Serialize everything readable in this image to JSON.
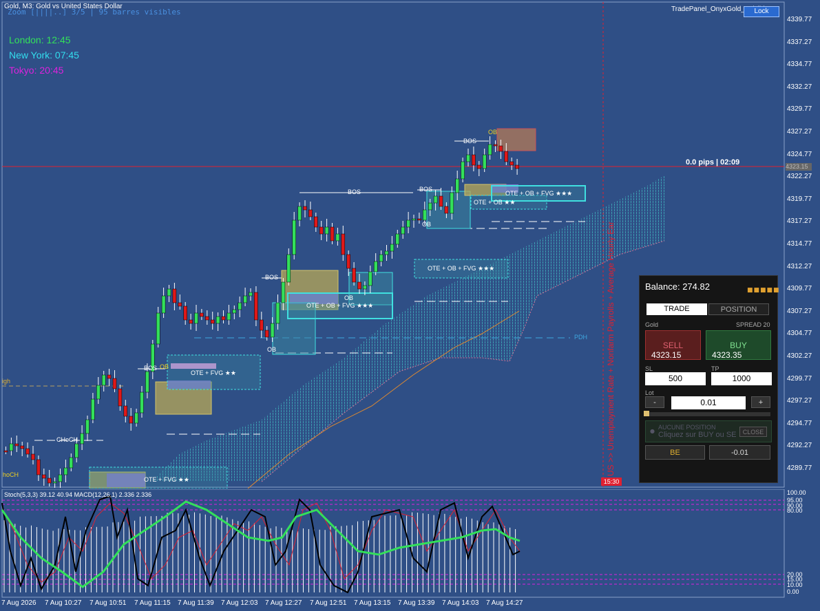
{
  "header": {
    "symbol_title": "Gold, M3:  Gold vs United States Dollar",
    "zoom_info": "Zoom [||||..] 3/5   |   95 barres visibles",
    "indicator_name": "TradePanel_OnyxGold_vVisible",
    "lock_label": "Lock"
  },
  "sessions": {
    "london": "London:  12:45",
    "newyork": "New York:  07:45",
    "tokyo": "Tokyo:  20:45"
  },
  "price_axis": [
    "4339.77",
    "4337.27",
    "4334.77",
    "4332.27",
    "4329.77",
    "4327.27",
    "4324.77",
    "4322.27",
    "4319.77",
    "4317.27",
    "4314.77",
    "4312.27",
    "4309.77",
    "4307.27",
    "4304.77",
    "4302.27",
    "4299.77",
    "4297.27",
    "4294.77",
    "4292.27",
    "4289.77"
  ],
  "current_price_tag": "4323.15",
  "pips_timer": "0.0 pips | 02:09",
  "time_axis": [
    "7 Aug 2026",
    "7 Aug 10:27",
    "7 Aug 10:51",
    "7 Aug 11:15",
    "7 Aug 11:39",
    "7 Aug 12:03",
    "7 Aug 12:27",
    "7 Aug 12:51",
    "7 Aug 13:15",
    "7 Aug 13:39",
    "7 Aug 14:03",
    "7 Aug 14:27"
  ],
  "news_vertical": "US >> Unemployment Rate + Nonfarm Payrolls + Average Hourly Ear",
  "news_time": "15:30",
  "oscillator": {
    "title": "Stoch(5,3,3) 39.12 40.94 MACD(12,26,1) 2.336 2.336",
    "levels": [
      "100.00",
      "95.00",
      "90.00",
      "80.00",
      "20.00",
      "15.00",
      "10.00",
      "0.00"
    ]
  },
  "smc_labels": {
    "bos1": "BOS",
    "bos2": "BOS",
    "bos3": "BOS",
    "bos4": "BOS",
    "bos5": "BOS",
    "ob1": "OB",
    "ob2": "OB",
    "ob3": "OB",
    "ob4": "OB",
    "ob5": "OB",
    "choch": "CHoCH",
    "choch_left": "hoCH",
    "high_left": "igh",
    "pdh": "PDH",
    "zone1": "OTE + FVG ★★",
    "zone2": "OTE + FVG ★★",
    "zone3": "OTE + OB + FVG ★★★",
    "zone4": "OTE + OB + FVG ★★★",
    "zone5": "OTE + OB ★★",
    "zone6": "OTE + OB + FVG ★★★"
  },
  "panel": {
    "balance": "Balance: 274.82",
    "tab_trade": "TRADE",
    "tab_position": "POSITION",
    "symbol": "Gold",
    "spread": "SPREAD 20",
    "sell_label": "SELL",
    "sell_price": "4323.15",
    "buy_label": "BUY",
    "buy_price": "4323.35",
    "sl_label": "SL",
    "sl_value": "500",
    "tp_label": "TP",
    "tp_value": "1000",
    "lot_label": "Lot",
    "lot_minus": "-",
    "lot_value": "0.01",
    "lot_plus": "+",
    "no_position": "AUCUNE POSITION",
    "no_position_hint": "Cliquez sur BUY ou SE",
    "close_label": "CLOSE",
    "be_label": "BE",
    "pnl_value": "-0.01"
  },
  "colors": {
    "background": "#2f4f86",
    "bull": "#33e05a",
    "bear": "#e01818",
    "london": "#33e05a",
    "newyork": "#33ddee",
    "tokyo": "#dd22dd"
  }
}
